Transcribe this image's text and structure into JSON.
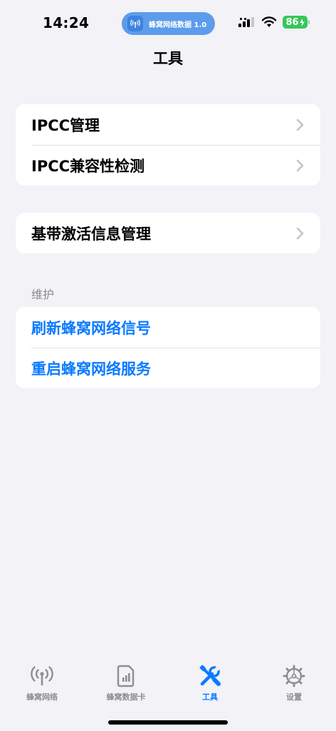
{
  "status_bar": {
    "time": "14:24",
    "island_text": "蜂窝网络数据 1.0",
    "battery": "86"
  },
  "nav": {
    "title": "工具"
  },
  "group1": {
    "items": [
      {
        "label": "IPCC管理"
      },
      {
        "label": "IPCC兼容性检测"
      }
    ]
  },
  "group2": {
    "items": [
      {
        "label": "基带激活信息管理"
      }
    ]
  },
  "maintenance": {
    "header": "维护",
    "items": [
      {
        "label": "刷新蜂窝网络信号"
      },
      {
        "label": "重启蜂窝网络服务"
      }
    ]
  },
  "tab_bar": {
    "tabs": [
      {
        "label": "蜂窝网络",
        "icon": "antenna-icon"
      },
      {
        "label": "蜂窝数据卡",
        "icon": "sim-card-icon"
      },
      {
        "label": "工具",
        "icon": "tools-icon"
      },
      {
        "label": "设置",
        "icon": "gear-icon"
      }
    ],
    "active_index": 2
  },
  "colors": {
    "accent": "#0a7aff",
    "background": "#f2f2f7",
    "battery": "#34c759",
    "island": "#5d9cec"
  }
}
